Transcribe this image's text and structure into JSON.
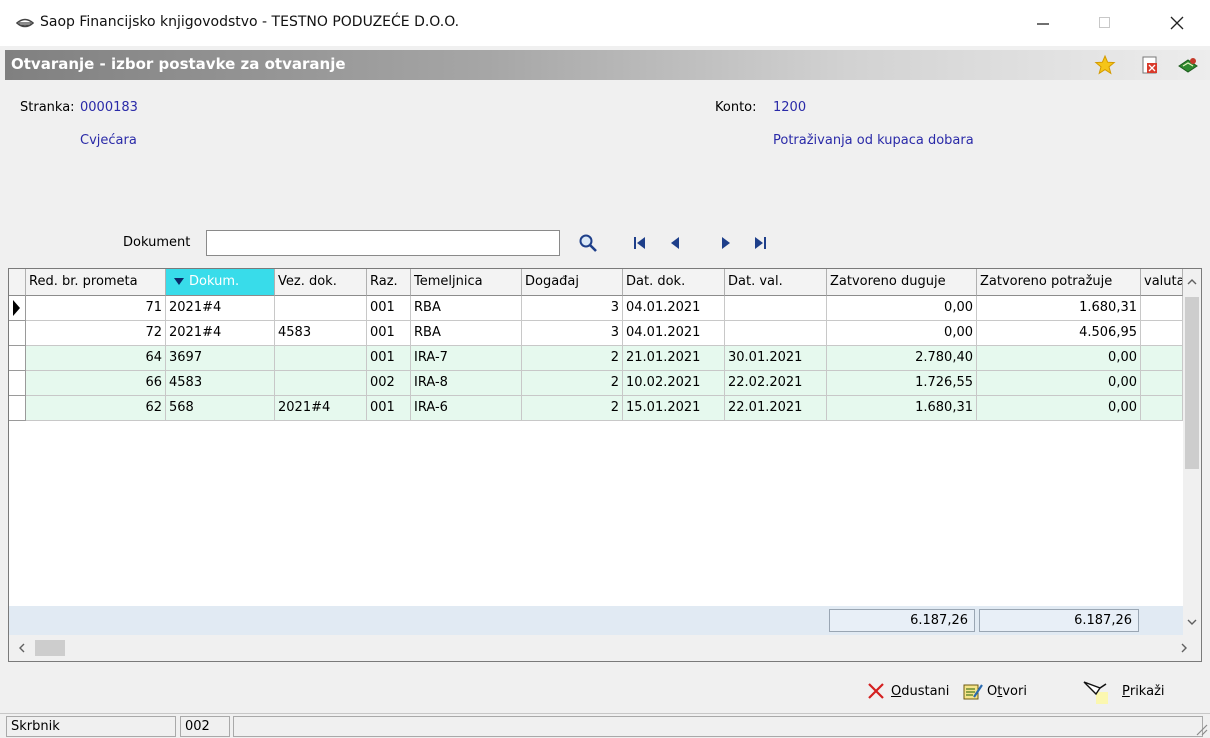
{
  "window": {
    "title": "Saop Financijsko knjigovodstvo - TESTNO PODUZEĆE D.O.O."
  },
  "form": {
    "title": "Otvaranje - izbor postavke za otvaranje"
  },
  "info": {
    "stranka_label": "Stranka:",
    "stranka_code": "0000183",
    "stranka_name": "Cvjećara",
    "konto_label": "Konto:",
    "konto_code": "1200",
    "konto_name": "Potraživanja od kupaca dobara"
  },
  "search": {
    "label": "Dokument",
    "value": ""
  },
  "table": {
    "columns": [
      "Red. br. prometa",
      "Dokum.",
      "Vez. dok.",
      "Raz.",
      "Temeljnica",
      "Događaj",
      "Dat. dok.",
      "Dat. val.",
      "Zatvoreno duguje",
      "Zatvoreno potražuje",
      "valuta"
    ],
    "rows": [
      [
        "71",
        "2021#4",
        "",
        "001",
        "RBA",
        "3",
        "04.01.2021",
        "",
        "0,00",
        "1.680,31",
        ""
      ],
      [
        "72",
        "2021#4",
        "4583",
        "001",
        "RBA",
        "3",
        "04.01.2021",
        "",
        "0,00",
        "4.506,95",
        ""
      ],
      [
        "64",
        "3697",
        "",
        "001",
        "IRA-7",
        "2",
        "21.01.2021",
        "30.01.2021",
        "2.780,40",
        "0,00",
        ""
      ],
      [
        "66",
        "4583",
        "",
        "002",
        "IRA-8",
        "2",
        "10.02.2021",
        "22.02.2021",
        "1.726,55",
        "0,00",
        ""
      ],
      [
        "62",
        "568",
        "2021#4",
        "001",
        "IRA-6",
        "2",
        "15.01.2021",
        "22.01.2021",
        "1.680,31",
        "0,00",
        ""
      ]
    ],
    "totals": {
      "duguje": "6.187,26",
      "potrazuje": "6.187,26"
    }
  },
  "buttons": {
    "odustani_u": "O",
    "odustani_rest": "dustani",
    "otvori_pre": "O",
    "otvori_u": "t",
    "otvori_rest": "vori",
    "prikazi_u": "P",
    "prikazi_rest": "rikaži"
  },
  "status": {
    "user": "Skrbnik",
    "code": "002"
  },
  "colors": {
    "sorted_header": "#38dcea",
    "closed_row": "#e6f9ee",
    "value_text": "#2a2aa8"
  }
}
